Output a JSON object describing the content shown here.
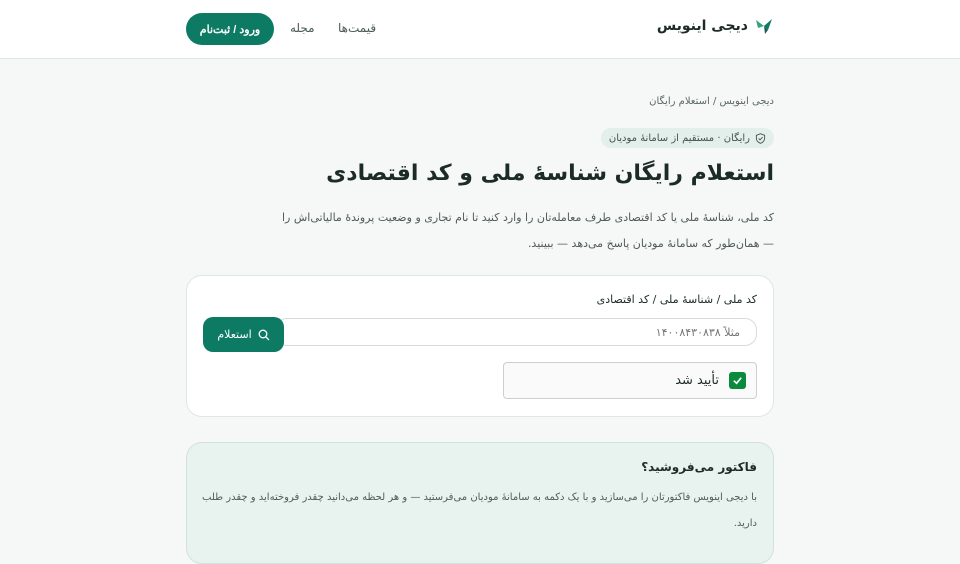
{
  "header": {
    "brand": "دیجی اینویس",
    "nav": {
      "pricing": "قیمت‌ها",
      "magazine": "مجله",
      "login": "ورود / ثبت‌نام"
    }
  },
  "breadcrumb": "دیجی اینویس / استعلام رایگان",
  "badge": "رایگان · مستقیم از سامانهٔ مودیان",
  "title": "استعلام رایگان شناسهٔ ملی و کد اقتصادی",
  "lead": "کد ملی، شناسهٔ ملی یا کد اقتصادی طرف معامله‌تان را وارد کنید تا نام تجاری و وضعیت پروندهٔ مالیاتی‌اش را — همان‌طور که سامانهٔ مودیان پاسخ می‌دهد — ببینید.",
  "form": {
    "label": "کد ملی / شناسهٔ ملی / کد اقتصادی",
    "placeholder": "مثلاً ۱۴۰۰۸۴۳۰۸۳۸",
    "button": "استعلام",
    "captcha": "تأیید شد"
  },
  "promo": {
    "title": "فاکتور می‌فروشید؟",
    "text": "با دیجی اینویس فاکتورتان را می‌سازید و با یک دکمه به سامانهٔ مودیان می‌فرستید — و هر لحظه می‌دانید چقدر فروخته‌اید و چقدر طلب دارید."
  },
  "colors": {
    "accent": "#0d7a64",
    "check": "#0a8a3c",
    "badge_bg": "#e3efeb",
    "promo_bg": "#e8f3ef"
  },
  "icons": [
    "logo-icon",
    "shield-check-icon",
    "search-icon",
    "checkmark-icon"
  ]
}
